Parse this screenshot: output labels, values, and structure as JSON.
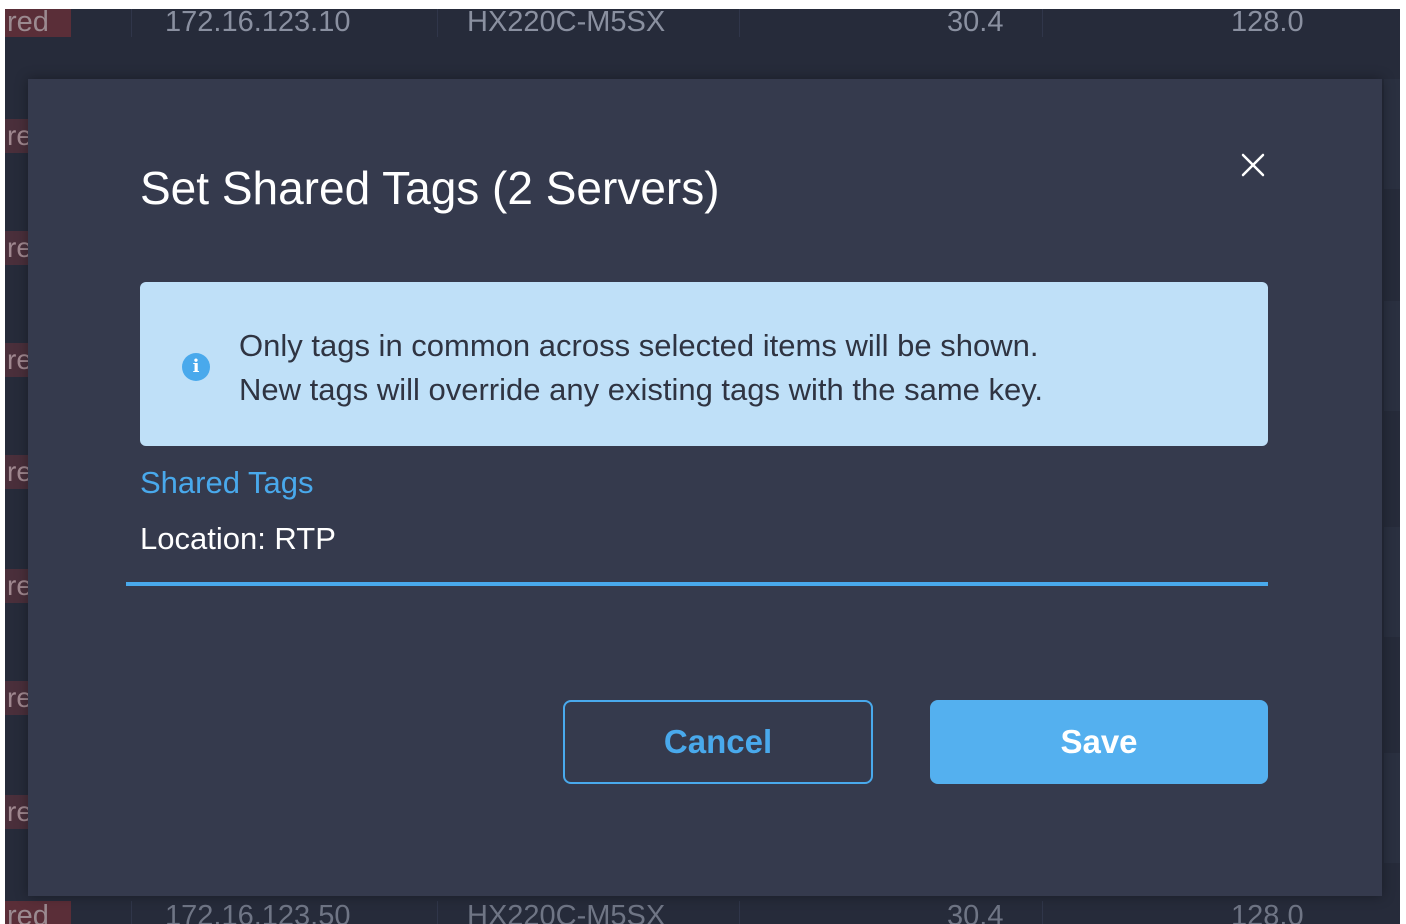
{
  "background": {
    "top_row": {
      "status": "red",
      "ip": "172.16.123.10",
      "model": "HX220C-M5SX",
      "cpu": "30.4",
      "memory": "128.0"
    },
    "bottom_row": {
      "status": "red",
      "ip": "172.16.123.50",
      "model": "HX220C-M5SX",
      "cpu": "30.4",
      "memory": "128.0"
    },
    "side_status_fragment": "re"
  },
  "dialog": {
    "title": "Set Shared Tags (2 Servers)",
    "close_icon": "close-icon",
    "info": {
      "icon": "info-icon",
      "icon_glyph": "i",
      "line1": "Only tags in common across selected items will be shown.",
      "line2": "New tags will override any existing tags with the same key."
    },
    "field": {
      "label": "Shared Tags",
      "value": "Location: RTP"
    },
    "cancel_label": "Cancel",
    "save_label": "Save"
  },
  "colors": {
    "accent": "#49a9ec",
    "dialog_bg": "#353a4d",
    "info_bg": "#bfe0f8",
    "page_bg": "#262b3a"
  }
}
